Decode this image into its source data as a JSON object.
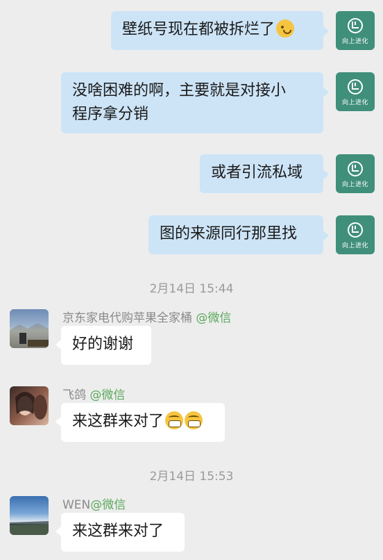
{
  "messages": [
    {
      "text": "壁纸号现在都被拆烂了",
      "emoji": "crying-laughing-emoji"
    },
    {
      "text_line1": "没啥困难的啊，主要就是对接小",
      "text_line2": "程序拿分销"
    },
    {
      "text": "或者引流私域"
    },
    {
      "text": "图的来源同行那里找"
    }
  ],
  "self_avatar": {
    "logo_label": "向上进化",
    "color": "#3f8f7a"
  },
  "timestamps": [
    "2月14日 15:44",
    "2月14日 15:53"
  ],
  "incoming": [
    {
      "sender": "京东家电代购苹果全家桶",
      "source": "@微信",
      "text": "好的谢谢"
    },
    {
      "sender": "飞鸽",
      "source": "@微信",
      "text": "来这群来对了",
      "emoji": "grinning-emoji"
    },
    {
      "sender": "WEN",
      "source": "@微信",
      "text": "来这群来对了"
    }
  ],
  "colors": {
    "background": "#ededed",
    "outgoing_bubble": "#cde4f7",
    "incoming_bubble": "#ffffff",
    "source_tag": "#5aa85b"
  }
}
